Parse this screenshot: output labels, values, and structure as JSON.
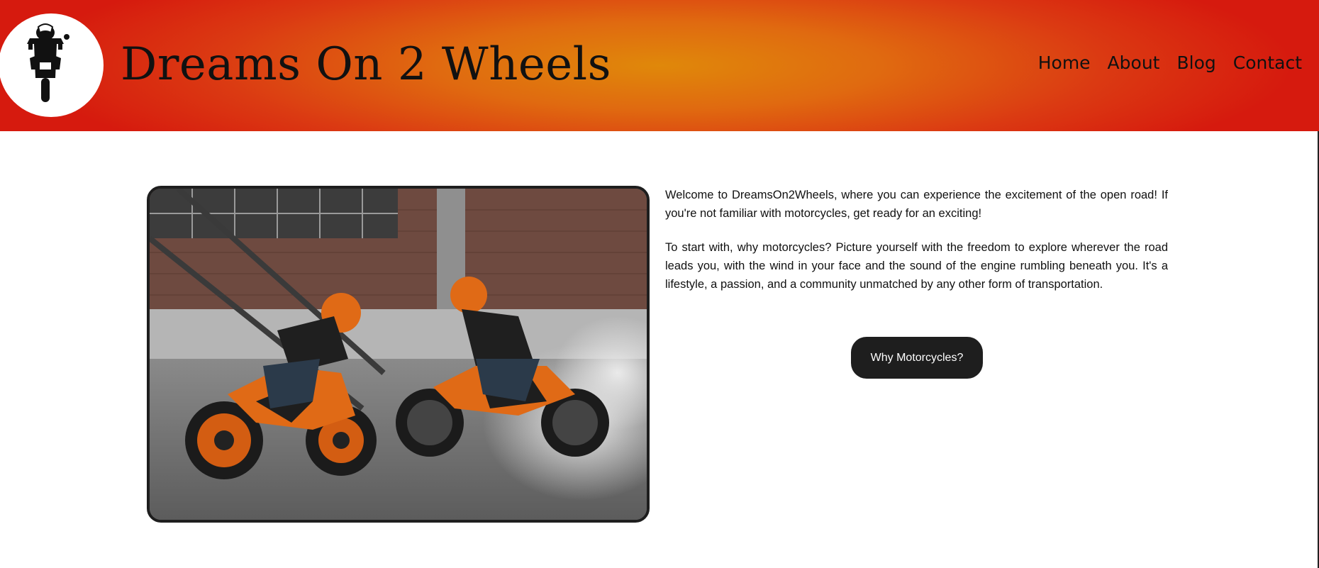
{
  "header": {
    "logo_icon": "motorcycle-icon",
    "site_title": "Dreams On 2 Wheels",
    "nav": [
      "Home",
      "About",
      "Blog",
      "Contact"
    ],
    "colors": {
      "gradient_center": "#e0880a",
      "gradient_edge": "#d61a0e"
    }
  },
  "main": {
    "image_alt": "two-orange-motorcycles-stunt-photo",
    "paragraphs": [
      "Welcome to DreamsOn2Wheels, where you can experience the excitement of the open road! If you're not familiar with motorcycles, get ready for an exciting!",
      "To start with, why motorcycles? Picture yourself with the freedom to explore wherever the road leads you, with the wind in your face and the sound of the engine rumbling beneath you. It's a lifestyle, a passion, and a community unmatched by any other form of transportation."
    ],
    "cta_label": "Why Motorcycles?"
  }
}
